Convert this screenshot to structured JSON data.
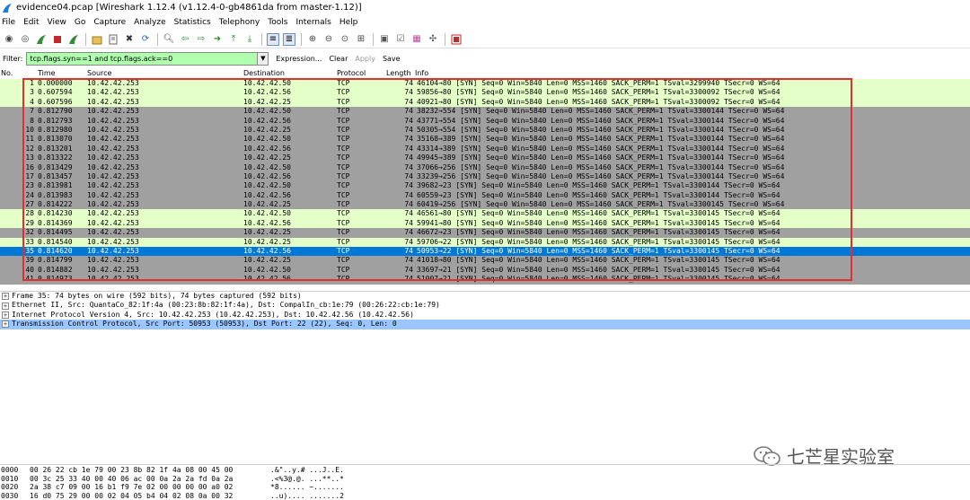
{
  "window": {
    "title": "evidence04.pcap  [Wireshark 1.12.4  (v1.12.4-0-gb4861da from master-1.12)]"
  },
  "menu": [
    "File",
    "Edit",
    "View",
    "Go",
    "Capture",
    "Analyze",
    "Statistics",
    "Telephony",
    "Tools",
    "Internals",
    "Help"
  ],
  "filter": {
    "label": "Filter:",
    "value": "tcp.flags.syn==1 and tcp.flags.ack==0",
    "expression": "Expression...",
    "clear": "Clear",
    "apply": "Apply",
    "save": "Save"
  },
  "columns": {
    "no": "No.",
    "time": "Time",
    "source": "Source",
    "destination": "Destination",
    "protocol": "Protocol",
    "length": "Length",
    "info": "Info"
  },
  "packets": [
    {
      "no": "1",
      "time": "0.000000",
      "src": "10.42.42.253",
      "dst": "10.42.42.50",
      "proto": "TCP",
      "len": "74",
      "info": "46104→80 [SYN] Seq=0 Win=5840 Len=0 MSS=1460 SACK_PERM=1 TSval=3299940 TSecr=0 WS=64",
      "style": "green"
    },
    {
      "no": "3",
      "time": "0.607594",
      "src": "10.42.42.253",
      "dst": "10.42.42.56",
      "proto": "TCP",
      "len": "74",
      "info": "59856→80 [SYN] Seq=0 Win=5840 Len=0 MSS=1460 SACK_PERM=1 TSval=3300092 TSecr=0 WS=64",
      "style": "green"
    },
    {
      "no": "4",
      "time": "0.607596",
      "src": "10.42.42.253",
      "dst": "10.42.42.25",
      "proto": "TCP",
      "len": "74",
      "info": "40921→80 [SYN] Seq=0 Win=5840 Len=0 MSS=1460 SACK_PERM=1 TSval=3300092 TSecr=0 WS=64",
      "style": "green"
    },
    {
      "no": "7",
      "time": "0.812790",
      "src": "10.42.42.253",
      "dst": "10.42.42.50",
      "proto": "TCP",
      "len": "74",
      "info": "38232→554 [SYN] Seq=0 Win=5840 Len=0 MSS=1460 SACK_PERM=1 TSval=3300144 TSecr=0 WS=64",
      "style": "gray"
    },
    {
      "no": "8",
      "time": "0.812793",
      "src": "10.42.42.253",
      "dst": "10.42.42.56",
      "proto": "TCP",
      "len": "74",
      "info": "43771→554 [SYN] Seq=0 Win=5840 Len=0 MSS=1460 SACK_PERM=1 TSval=3300144 TSecr=0 WS=64",
      "style": "gray"
    },
    {
      "no": "10",
      "time": "0.812980",
      "src": "10.42.42.253",
      "dst": "10.42.42.25",
      "proto": "TCP",
      "len": "74",
      "info": "50305→554 [SYN] Seq=0 Win=5840 Len=0 MSS=1460 SACK_PERM=1 TSval=3300144 TSecr=0 WS=64",
      "style": "gray"
    },
    {
      "no": "11",
      "time": "0.813070",
      "src": "10.42.42.253",
      "dst": "10.42.42.50",
      "proto": "TCP",
      "len": "74",
      "info": "35168→389 [SYN] Seq=0 Win=5840 Len=0 MSS=1460 SACK_PERM=1 TSval=3300144 TSecr=0 WS=64",
      "style": "gray"
    },
    {
      "no": "12",
      "time": "0.813201",
      "src": "10.42.42.253",
      "dst": "10.42.42.56",
      "proto": "TCP",
      "len": "74",
      "info": "43314→389 [SYN] Seq=0 Win=5840 Len=0 MSS=1460 SACK_PERM=1 TSval=3300144 TSecr=0 WS=64",
      "style": "gray"
    },
    {
      "no": "13",
      "time": "0.813322",
      "src": "10.42.42.253",
      "dst": "10.42.42.25",
      "proto": "TCP",
      "len": "74",
      "info": "49945→389 [SYN] Seq=0 Win=5840 Len=0 MSS=1460 SACK_PERM=1 TSval=3300144 TSecr=0 WS=64",
      "style": "gray"
    },
    {
      "no": "16",
      "time": "0.813429",
      "src": "10.42.42.253",
      "dst": "10.42.42.50",
      "proto": "TCP",
      "len": "74",
      "info": "37066→256 [SYN] Seq=0 Win=5840 Len=0 MSS=1460 SACK_PERM=1 TSval=3300144 TSecr=0 WS=64",
      "style": "gray"
    },
    {
      "no": "17",
      "time": "0.813457",
      "src": "10.42.42.253",
      "dst": "10.42.42.56",
      "proto": "TCP",
      "len": "74",
      "info": "33239→256 [SYN] Seq=0 Win=5840 Len=0 MSS=1460 SACK_PERM=1 TSval=3300144 TSecr=0 WS=64",
      "style": "gray"
    },
    {
      "no": "23",
      "time": "0.813981",
      "src": "10.42.42.253",
      "dst": "10.42.42.50",
      "proto": "TCP",
      "len": "74",
      "info": "39682→23 [SYN] Seq=0 Win=5840 Len=0 MSS=1460 SACK_PERM=1 TSval=3300144 TSecr=0 WS=64",
      "style": "gray"
    },
    {
      "no": "24",
      "time": "0.813983",
      "src": "10.42.42.253",
      "dst": "10.42.42.56",
      "proto": "TCP",
      "len": "74",
      "info": "60559→23 [SYN] Seq=0 Win=5840 Len=0 MSS=1460 SACK_PERM=1 TSval=3300144 TSecr=0 WS=64",
      "style": "gray"
    },
    {
      "no": "27",
      "time": "0.814222",
      "src": "10.42.42.253",
      "dst": "10.42.42.25",
      "proto": "TCP",
      "len": "74",
      "info": "60419→256 [SYN] Seq=0 Win=5840 Len=0 MSS=1460 SACK_PERM=1 TSval=3300145 TSecr=0 WS=64",
      "style": "gray"
    },
    {
      "no": "28",
      "time": "0.814230",
      "src": "10.42.42.253",
      "dst": "10.42.42.50",
      "proto": "TCP",
      "len": "74",
      "info": "46561→80 [SYN] Seq=0 Win=5840 Len=0 MSS=1460 SACK_PERM=1 TSval=3300145 TSecr=0 WS=64",
      "style": "green"
    },
    {
      "no": "29",
      "time": "0.814369",
      "src": "10.42.42.253",
      "dst": "10.42.42.56",
      "proto": "TCP",
      "len": "74",
      "info": "59941→80 [SYN] Seq=0 Win=5840 Len=0 MSS=1460 SACK_PERM=1 TSval=3300145 TSecr=0 WS=64",
      "style": "green"
    },
    {
      "no": "32",
      "time": "0.814495",
      "src": "10.42.42.253",
      "dst": "10.42.42.25",
      "proto": "TCP",
      "len": "74",
      "info": "46672→23 [SYN] Seq=0 Win=5840 Len=0 MSS=1460 SACK_PERM=1 TSval=3300145 TSecr=0 WS=64",
      "style": "gray"
    },
    {
      "no": "33",
      "time": "0.814540",
      "src": "10.42.42.253",
      "dst": "10.42.42.25",
      "proto": "TCP",
      "len": "74",
      "info": "59706→22 [SYN] Seq=0 Win=5840 Len=0 MSS=1460 SACK_PERM=1 TSval=3300145 TSecr=0 WS=64",
      "style": "green"
    },
    {
      "no": "35",
      "time": "0.814620",
      "src": "10.42.42.253",
      "dst": "10.42.42.56",
      "proto": "TCP",
      "len": "74",
      "info": "50953→22 [SYN] Seq=0 Win=5840 Len=0 MSS=1460 SACK_PERM=1 TSval=3300145 TSecr=0 WS=64",
      "style": "sel"
    },
    {
      "no": "39",
      "time": "0.814799",
      "src": "10.42.42.253",
      "dst": "10.42.42.25",
      "proto": "TCP",
      "len": "74",
      "info": "41018→80 [SYN] Seq=0 Win=5840 Len=0 MSS=1460 SACK_PERM=1 TSval=3300145 TSecr=0 WS=64",
      "style": "gray"
    },
    {
      "no": "40",
      "time": "0.814882",
      "src": "10.42.42.253",
      "dst": "10.42.42.50",
      "proto": "TCP",
      "len": "74",
      "info": "33697→21 [SYN] Seq=0 Win=5840 Len=0 MSS=1460 SACK_PERM=1 TSval=3300145 TSecr=0 WS=64",
      "style": "gray"
    },
    {
      "no": "41",
      "time": "0.814973",
      "src": "10.42.42.253",
      "dst": "10.42.42.56",
      "proto": "TCP",
      "len": "74",
      "info": "51007→21 [SYN] Seq=0 Win=5840 Len=0 MSS=1460 SACK_PERM=1 TSval=3300145 TSecr=0 WS=64",
      "style": "gray"
    }
  ],
  "details": [
    {
      "text": "Frame 35: 74 bytes on wire (592 bits), 74 bytes captured (592 bits)",
      "selected": false
    },
    {
      "text": "Ethernet II, Src: QuantaCo_82:1f:4a (00:23:8b:82:1f:4a), Dst: CompalIn_cb:1e:79 (00:26:22:cb:1e:79)",
      "selected": false
    },
    {
      "text": "Internet Protocol Version 4, Src: 10.42.42.253 (10.42.42.253), Dst: 10.42.42.56 (10.42.42.56)",
      "selected": false
    },
    {
      "text": "Transmission Control Protocol, Src Port: 50953 (50953), Dst Port: 22 (22), Seq: 0, Len: 0",
      "selected": true
    }
  ],
  "bytes": [
    {
      "offset": "0000",
      "hex": "00 26 22 cb 1e 79 00 23  8b 82 1f 4a 08 00 45 00",
      "ascii": ".&\"..y.# ...J..E."
    },
    {
      "offset": "0010",
      "hex": "00 3c 25 33 40 00 40 06  ac 00 0a 2a 2a fd 0a 2a",
      "ascii": ".<%3@.@. ...**..*"
    },
    {
      "offset": "0020",
      "hex": "2a 38 c7 09 00 16 b1 f9  7e 02 00 00 00 00 a0 02",
      "ascii": "*8...... ~......."
    },
    {
      "offset": "0030",
      "hex": "16 d0 75 29 00 00 02 04  05 b4 04 02 08 0a 00 32",
      "ascii": "..u).... .......2"
    }
  ],
  "watermark": {
    "text": "七芒星实验室"
  }
}
